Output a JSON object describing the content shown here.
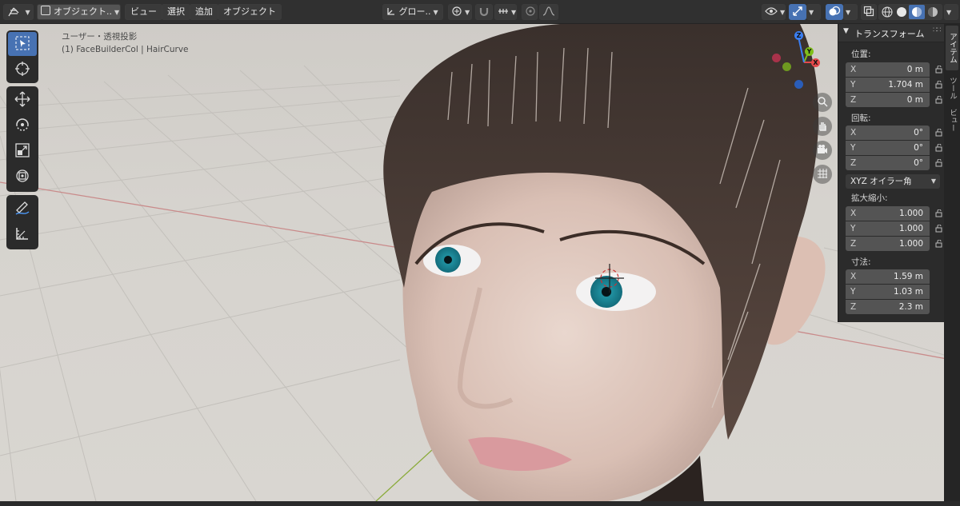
{
  "header": {
    "mode_label": "オブジェクト..",
    "menus": [
      "ビュー",
      "選択",
      "追加",
      "オブジェクト"
    ],
    "transform_orientation": "グロー..",
    "shading_modes": [
      "wireframe",
      "solid",
      "material-preview",
      "rendered"
    ],
    "active_shading": "material-preview"
  },
  "viewport": {
    "info_line_1": "ユーザー・透視投影",
    "info_line_2": "(1) FaceBuilderCol | HairCurve"
  },
  "toolbar": {
    "tools": [
      "select-box",
      "cursor",
      "move",
      "rotate",
      "scale",
      "transform",
      "annotate",
      "measure"
    ],
    "active_tool": "select-box"
  },
  "gizmo": {
    "axes": [
      "X",
      "Y",
      "Z"
    ],
    "colors": {
      "x": "#e3494b",
      "y": "#7fbf1a",
      "z": "#3a7ef2"
    }
  },
  "npanel": {
    "title": "トランスフォーム",
    "location": {
      "label": "位置:",
      "x": "0 m",
      "y": "1.704 m",
      "z": "0 m"
    },
    "rotation": {
      "label": "回転:",
      "x": "0°",
      "y": "0°",
      "z": "0°"
    },
    "rotation_mode": "XYZ オイラー角",
    "scale": {
      "label": "拡大縮小:",
      "x": "1.000",
      "y": "1.000",
      "z": "1.000"
    },
    "dimensions": {
      "label": "寸法:",
      "x": "1.59 m",
      "y": "1.03 m",
      "z": "2.3 m"
    },
    "axis": {
      "x": "X",
      "y": "Y",
      "z": "Z"
    }
  },
  "tabs": [
    "アイテム",
    "ツール",
    "ビュー"
  ],
  "colors": {
    "accent": "#4772b3",
    "header": "#303030",
    "panel": "#2b2b2b",
    "field": "#545454"
  }
}
